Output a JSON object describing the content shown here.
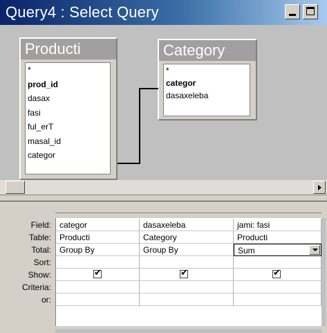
{
  "window": {
    "title": "Query4 : Select Query"
  },
  "tables": [
    {
      "name": "Producti",
      "fields": [
        "*",
        "prod_id",
        "dasax",
        "fasi",
        "ful_erT",
        "masal_id",
        "categor"
      ],
      "bold_field": "prod_id"
    },
    {
      "name": "Category",
      "fields": [
        "*",
        "categor",
        "dasaxeleba"
      ],
      "bold_field": "categor"
    }
  ],
  "grid": {
    "row_labels": {
      "field": "Field:",
      "table": "Table:",
      "total": "Total:",
      "sort": "Sort:",
      "show": "Show:",
      "criteria": "Criteria:",
      "or": "or:"
    },
    "columns": [
      {
        "field": "categor",
        "table": "Producti",
        "total": "Group By",
        "sort": "",
        "show": true
      },
      {
        "field": "dasaxeleba",
        "table": "Category",
        "total": "Group By",
        "sort": "",
        "show": true
      },
      {
        "field": "jami: fasi",
        "table": "Producti",
        "total": "Sum",
        "sort": "",
        "show": true
      }
    ]
  },
  "colors": {
    "titlebar_start": "#0a246a",
    "titlebar_end": "#a6caf0",
    "window_face": "#d4d0c8"
  }
}
